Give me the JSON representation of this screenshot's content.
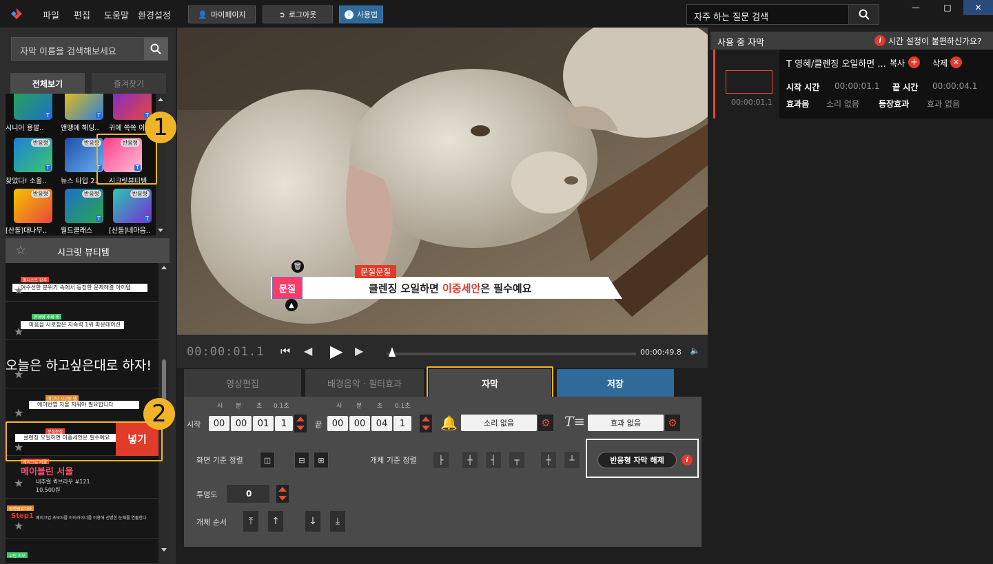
{
  "menu": [
    "파일",
    "편집",
    "도움말",
    "환경설정"
  ],
  "top_buttons": {
    "mypage": "마이페이지",
    "logout": "로그아웃",
    "help": "사용법"
  },
  "faq_search": {
    "placeholder": "자주 하는 질문 검색"
  },
  "left": {
    "search_placeholder": "자막 이름을 검색해보세요",
    "tabs": {
      "all": "전체보기",
      "favorites": "즐겨찾기"
    },
    "thumbs": [
      {
        "label": "시니어 용팔.."
      },
      {
        "label": "앤땡에 해딩.."
      },
      {
        "label": "귀에 쏙쏙 이.."
      },
      {
        "label": "찾았다! 소울.."
      },
      {
        "label": "뉴스 타입 2.."
      },
      {
        "label": "시크릿뷰티템"
      },
      {
        "label": "[산돌]대나무.."
      },
      {
        "label": "월드클래스"
      },
      {
        "label": "[산돌]네마음.."
      }
    ],
    "thumb_tag": "반응형",
    "thumb_badge": "T",
    "fav_title": "시크릿 뷰티템",
    "templates": [
      {
        "tag": "혈니스트 강추",
        "text": "여수선한 분위기 속에서 등장한 문제해결 아이템"
      },
      {
        "tag": "인생템 수세 중",
        "text": "마음을 사로잡은 지속력 1위 파운데이션"
      },
      {
        "text": "오늘은 하고싶은대로 하자!"
      },
      {
        "tag": "에디터 시크릿 템",
        "text": "에이번엽 지울 지워야 필요합니다"
      },
      {
        "tag": "문질문질",
        "text": "클렌징 오일하면 이중세안은 필수예요",
        "insert": "넣기"
      },
      {
        "tag": "메이크업 서울",
        "title": "메이블린 서울",
        "sub1": "내추럴 퀵브라우 #121",
        "sub2": "10,500원"
      },
      {
        "tag": "원앤원뷰티바",
        "title": "Step1",
        "text": "메이크업 초보자를 아이라이너를 이용해 선명한 눈매를 연출한다"
      },
      {
        "tag": "고민 피부"
      }
    ]
  },
  "video": {
    "caption_tag": "문질문질",
    "caption_pre": "클렌징 오일하면 ",
    "caption_highlight": "이중세안",
    "caption_post": "은 필수예요",
    "logo_text": "문질"
  },
  "transport": {
    "time": "00:00:01.1",
    "end": "00:00:49.8",
    "progress": 0.0
  },
  "main_tabs": {
    "edit": "영상편집",
    "bgm": "배경음악 · 필터효과",
    "subtitle": "자막",
    "save": "저장"
  },
  "editor": {
    "start_label": "시작",
    "end_label": "끝",
    "unit_labels": [
      "시",
      "분",
      "초",
      "0.1초"
    ],
    "start_time": [
      "00",
      "00",
      "01",
      "1"
    ],
    "end_time": [
      "00",
      "00",
      "04",
      "1"
    ],
    "sound": "소리 없음",
    "effect": "효과 없음",
    "screen_align_label": "화면 기준 정렬",
    "obj_align_label": "개체 기준 정렬",
    "release_btn": "반응형 자막 해제",
    "opacity_label": "투명도",
    "opacity_value": "0",
    "order_label": "개체 순서"
  },
  "right": {
    "title": "사용 중 자막",
    "time_help": "시간 설정이 불편하신가요?",
    "item": {
      "name": "T 영혜/클렌징 오일하면 ...",
      "copy": "복사",
      "delete": "삭제",
      "start_label": "시작 시간",
      "start": "00:00:01.1",
      "end_label": "끝 시간",
      "end": "00:00:04.1",
      "sfx_label": "효과음",
      "sfx": "소리 없음",
      "enter_label": "등장효과",
      "enter": "효과 없음",
      "thumb_time": "00:00:01.1"
    }
  },
  "callouts": {
    "one": "1",
    "two": "2"
  },
  "colors": {
    "accent_red": "#e03b2b",
    "callout": "#f0b429",
    "save_tab": "#2f6a9a"
  }
}
